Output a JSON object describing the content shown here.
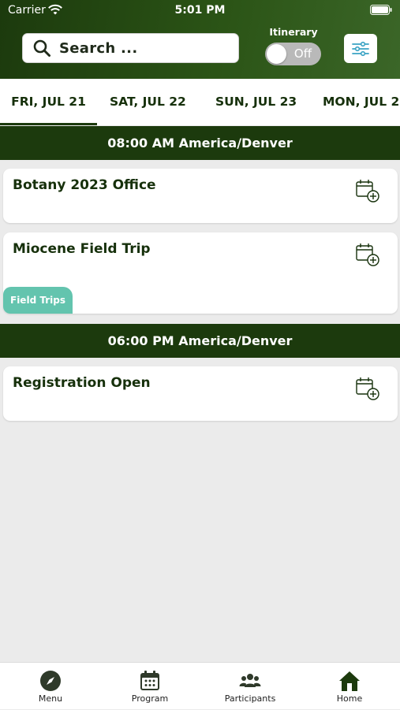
{
  "status": {
    "carrier": "Carrier",
    "time": "5:01 PM"
  },
  "search": {
    "placeholder": "Search ..."
  },
  "itinerary": {
    "label": "Itinerary",
    "toggle_text": "Off"
  },
  "tabs": [
    {
      "label": "FRI, JUL 21",
      "active": true
    },
    {
      "label": "SAT, JUL 22"
    },
    {
      "label": "SUN, JUL 23"
    },
    {
      "label": "MON, JUL 2"
    }
  ],
  "sections": [
    {
      "time": "08:00 AM America/Denver",
      "events": [
        {
          "title": "Botany 2023 Office"
        },
        {
          "title": "Miocene Field Trip",
          "tag": "Field Trips"
        }
      ]
    },
    {
      "time": "06:00 PM America/Denver",
      "events": [
        {
          "title": "Registration Open"
        }
      ]
    }
  ],
  "nav": [
    {
      "label": "Menu",
      "icon": "compass-icon"
    },
    {
      "label": "Program",
      "icon": "calendar-icon"
    },
    {
      "label": "Participants",
      "icon": "people-icon"
    },
    {
      "label": "Home",
      "icon": "home-icon"
    }
  ],
  "colors": {
    "primary": "#1c3a0d",
    "accent": "#63c4ae",
    "tab_active": "#1c3a0d"
  }
}
